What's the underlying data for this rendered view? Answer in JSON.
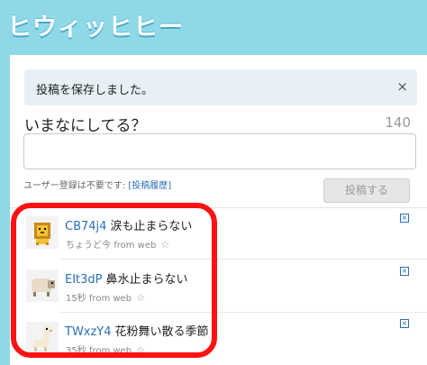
{
  "app": {
    "logo": "ヒウィッヒヒー"
  },
  "notice": {
    "text": "投稿を保存しました。",
    "close_icon": "×"
  },
  "composer": {
    "prompt": "いまなにしてる？",
    "counter": "140",
    "note_prefix": "ユーザー登録は不要です:",
    "note_link": "[投稿履歴]",
    "post_label": "投稿する"
  },
  "tweets": [
    {
      "user": "CB74j4",
      "text": "涙も止まらない",
      "time": "ちょうど今",
      "source": "from web",
      "avatar": "lion-avatar"
    },
    {
      "user": "EIt3dP",
      "text": "鼻水止まらない",
      "time": "15秒",
      "source": "from web",
      "avatar": "sheep-avatar"
    },
    {
      "user": "TWxzY4",
      "text": "花粉舞い散る季節",
      "time": "35秒",
      "source": "from web",
      "avatar": "alpaca-avatar"
    }
  ],
  "colors": {
    "background": "#8fd8e8",
    "link": "#2b6fb7",
    "highlight": "#ff1111"
  }
}
